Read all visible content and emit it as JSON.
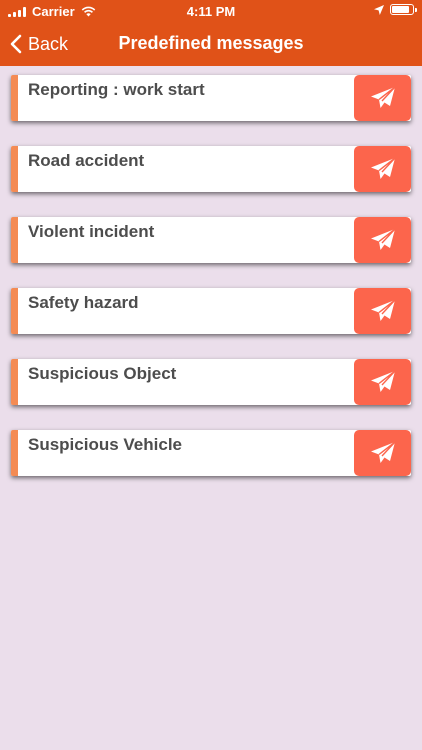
{
  "status_bar": {
    "carrier": "Carrier",
    "time": "4:11 PM"
  },
  "nav": {
    "back_label": "Back",
    "title": "Predefined messages"
  },
  "messages": [
    {
      "label": "Reporting : work start"
    },
    {
      "label": "Road accident"
    },
    {
      "label": "Violent incident"
    },
    {
      "label": "Safety hazard"
    },
    {
      "label": "Suspicious Object"
    },
    {
      "label": "Suspicious Vehicle"
    }
  ],
  "colors": {
    "header": "#e05218",
    "background": "#ebdeeb",
    "accent": "#f48b54",
    "send_button": "#fc654c",
    "label_text": "#4d4d4d"
  },
  "icons": {
    "back": "chevron-left-icon",
    "send": "paper-plane-icon"
  }
}
